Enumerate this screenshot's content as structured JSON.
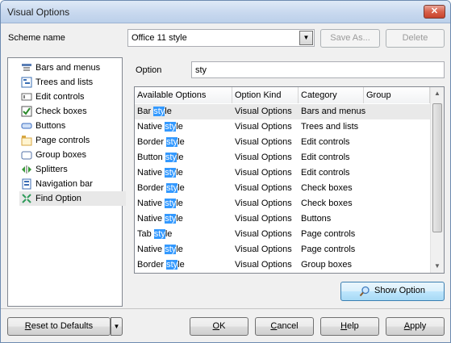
{
  "window": {
    "title": "Visual Options",
    "close_label": "✕"
  },
  "scheme": {
    "label": "Scheme name",
    "value": "Office 11 style",
    "save_as": "Save As...",
    "delete": "Delete"
  },
  "nav": {
    "items": [
      {
        "label": "Bars and menus",
        "icon": "bars-menus-icon",
        "color": "#5a7fb5"
      },
      {
        "label": "Trees and lists",
        "icon": "tree-list-icon",
        "color": "#3a6fb4"
      },
      {
        "label": "Edit controls",
        "icon": "edit-control-icon",
        "color": "#666666"
      },
      {
        "label": "Check boxes",
        "icon": "checkbox-icon",
        "color": "#2a8a2a"
      },
      {
        "label": "Buttons",
        "icon": "button-icon",
        "color": "#3b6cc0"
      },
      {
        "label": "Page controls",
        "icon": "page-control-icon",
        "color": "#d7a640"
      },
      {
        "label": "Group boxes",
        "icon": "group-box-icon",
        "color": "#5573a8"
      },
      {
        "label": "Splitters",
        "icon": "splitter-icon",
        "color": "#3a9a3a"
      },
      {
        "label": "Navigation bar",
        "icon": "navigation-bar-icon",
        "color": "#3c6db4"
      },
      {
        "label": "Find Option",
        "icon": "find-option-icon",
        "color": "#2f9b5a"
      }
    ],
    "selected": "Find Option"
  },
  "find": {
    "option_label": "Option",
    "search_value": "sty",
    "columns": [
      "Available Options",
      "Option Kind",
      "Category",
      "Group"
    ],
    "rows": [
      {
        "pre": "Bar ",
        "hl": "sty",
        "post": "le",
        "kind": "Visual Options",
        "category": "Bars and menus",
        "group": ""
      },
      {
        "pre": "Native ",
        "hl": "sty",
        "post": "le",
        "kind": "Visual Options",
        "category": "Trees and lists",
        "group": ""
      },
      {
        "pre": "Border ",
        "hl": "sty",
        "post": "le",
        "kind": "Visual Options",
        "category": "Edit controls",
        "group": ""
      },
      {
        "pre": "Button ",
        "hl": "sty",
        "post": "le",
        "kind": "Visual Options",
        "category": "Edit controls",
        "group": ""
      },
      {
        "pre": "Native ",
        "hl": "sty",
        "post": "le",
        "kind": "Visual Options",
        "category": "Edit controls",
        "group": ""
      },
      {
        "pre": "Border ",
        "hl": "sty",
        "post": "le",
        "kind": "Visual Options",
        "category": "Check boxes",
        "group": ""
      },
      {
        "pre": "Native ",
        "hl": "sty",
        "post": "le",
        "kind": "Visual Options",
        "category": "Check boxes",
        "group": ""
      },
      {
        "pre": "Native ",
        "hl": "sty",
        "post": "le",
        "kind": "Visual Options",
        "category": "Buttons",
        "group": ""
      },
      {
        "pre": "Tab ",
        "hl": "sty",
        "post": "le",
        "kind": "Visual Options",
        "category": "Page controls",
        "group": ""
      },
      {
        "pre": "Native ",
        "hl": "sty",
        "post": "le",
        "kind": "Visual Options",
        "category": "Page controls",
        "group": ""
      },
      {
        "pre": "Border ",
        "hl": "sty",
        "post": "le",
        "kind": "Visual Options",
        "category": "Group boxes",
        "group": ""
      }
    ],
    "show_option": "Show Option"
  },
  "footer": {
    "reset_pre": "",
    "reset_u": "R",
    "reset_post": "eset to Defaults",
    "ok_u": "O",
    "ok_post": "K",
    "cancel_u": "C",
    "cancel_post": "ancel",
    "help_u": "H",
    "help_post": "elp",
    "apply_u": "A",
    "apply_post": "pply"
  }
}
